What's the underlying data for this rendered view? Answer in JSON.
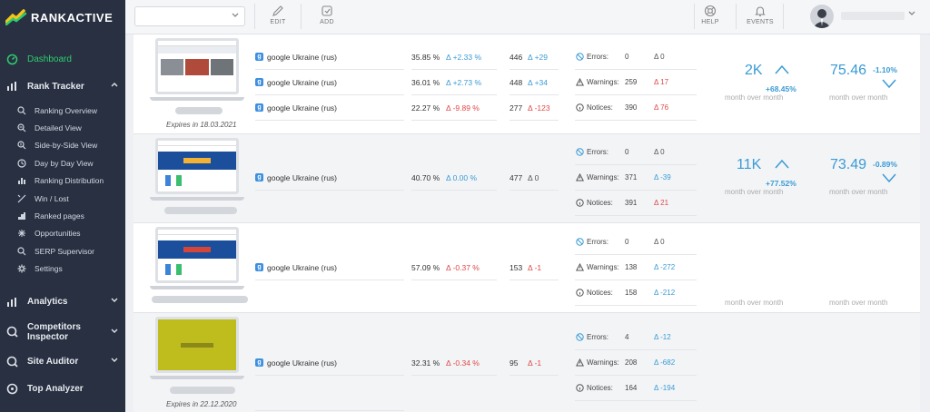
{
  "brand": {
    "name_left": "RANK",
    "name_right": "ACTIVE",
    "accent": "#2ecc71",
    "sidebar_bg": "#283041"
  },
  "sidebar": {
    "dashboard": "Dashboard",
    "rank_tracker": "Rank Tracker",
    "sub_items": [
      {
        "label": "Ranking Overview",
        "icon": "search-icon"
      },
      {
        "label": "Detailed View",
        "icon": "search-detail-icon"
      },
      {
        "label": "Side-by-Side View",
        "icon": "compare-icon"
      },
      {
        "label": "Day by Day View",
        "icon": "calendar-clock-icon"
      },
      {
        "label": "Ranking Distribution",
        "icon": "distribution-icon"
      },
      {
        "label": "Win / Lost",
        "icon": "win-lost-icon"
      },
      {
        "label": "Ranked pages",
        "icon": "ranked-pages-icon"
      },
      {
        "label": "Opportunities",
        "icon": "opportunities-icon"
      },
      {
        "label": "SERP Supervisor",
        "icon": "serp-icon"
      },
      {
        "label": "Settings",
        "icon": "gear-icon"
      }
    ],
    "analytics": "Analytics",
    "competitors_line1": "Competitors",
    "competitors_line2": "Inspector",
    "site_auditor": "Site Auditor",
    "top_analyzer": "Top Analyzer"
  },
  "toolbar": {
    "edit": "EDIT",
    "add": "ADD",
    "help": "HELP",
    "events": "EVENTS"
  },
  "projects": [
    {
      "expires": "Expires in 18.03.2021",
      "engines": [
        {
          "name": "google Ukraine (rus)",
          "vis": "35.85 %",
          "vis_delta": "Δ +2.33 %",
          "vis_dir": "up",
          "count": "446",
          "count_delta": "Δ +29",
          "count_dir": "up"
        },
        {
          "name": "google Ukraine (rus)",
          "vis": "36.01 %",
          "vis_delta": "Δ +2.73 %",
          "vis_dir": "up",
          "count": "448",
          "count_delta": "Δ +34",
          "count_dir": "up"
        },
        {
          "name": "google Ukraine (rus)",
          "vis": "22.27 %",
          "vis_delta": "Δ -9.89 %",
          "vis_dir": "dn",
          "count": "277",
          "count_delta": "Δ -123",
          "count_dir": "dn"
        }
      ],
      "audit": {
        "errors": "0",
        "errors_delta": "Δ 0",
        "errors_dir": "zero",
        "warnings": "259",
        "warnings_delta": "Δ 17",
        "warnings_dir": "dn",
        "notices": "390",
        "notices_delta": "Δ 76",
        "notices_dir": "dn"
      },
      "m1": {
        "value": "2K",
        "change": "+68.45%",
        "label": "month over month",
        "trend": "up"
      },
      "m2": {
        "value": "75.46",
        "change": "-1.10%",
        "label": "month over month",
        "trend": "down"
      }
    },
    {
      "expires": "",
      "engines": [
        {
          "name": "google Ukraine (rus)",
          "vis": "40.70 %",
          "vis_delta": "Δ 0.00 %",
          "vis_dir": "up",
          "count": "477",
          "count_delta": "Δ 0",
          "count_dir": "zero"
        }
      ],
      "audit": {
        "errors": "0",
        "errors_delta": "Δ 0",
        "errors_dir": "zero",
        "warnings": "371",
        "warnings_delta": "Δ -39",
        "warnings_dir": "up",
        "notices": "391",
        "notices_delta": "Δ 21",
        "notices_dir": "dn"
      },
      "m1": {
        "value": "11K",
        "change": "+77.52%",
        "label": "month over month",
        "trend": "up"
      },
      "m2": {
        "value": "73.49",
        "change": "-0.89%",
        "label": "month over month",
        "trend": "down"
      }
    },
    {
      "expires": "",
      "engines": [
        {
          "name": "google Ukraine (rus)",
          "vis": "57.09 %",
          "vis_delta": "Δ -0.37 %",
          "vis_dir": "dn",
          "count": "153",
          "count_delta": "Δ -1",
          "count_dir": "dn"
        }
      ],
      "audit": {
        "errors": "0",
        "errors_delta": "Δ 0",
        "errors_dir": "zero",
        "warnings": "138",
        "warnings_delta": "Δ -272",
        "warnings_dir": "up",
        "notices": "158",
        "notices_delta": "Δ -212",
        "notices_dir": "up"
      },
      "m1": {
        "value": "",
        "change": "",
        "label": "month over month",
        "trend": "none"
      },
      "m2": {
        "value": "",
        "change": "",
        "label": "month over month",
        "trend": "none"
      }
    },
    {
      "expires": "Expires in 22.12.2020",
      "engines": [
        {
          "name": "google Ukraine (rus)",
          "vis": "32.31 %",
          "vis_delta": "Δ -0.34 %",
          "vis_dir": "dn",
          "count": "95",
          "count_delta": "Δ -1",
          "count_dir": "dn"
        }
      ],
      "audit": {
        "errors": "4",
        "errors_delta": "Δ -12",
        "errors_dir": "up",
        "warnings": "208",
        "warnings_delta": "Δ -682",
        "warnings_dir": "up",
        "notices": "164",
        "notices_delta": "Δ -194",
        "notices_dir": "up"
      },
      "m1": {
        "value": "",
        "change": "",
        "label": "",
        "trend": "none"
      },
      "m2": {
        "value": "",
        "change": "",
        "label": "",
        "trend": "none"
      }
    }
  ],
  "labels": {
    "errors": "Errors:",
    "warnings": "Warnings:",
    "notices": "Notices:"
  }
}
